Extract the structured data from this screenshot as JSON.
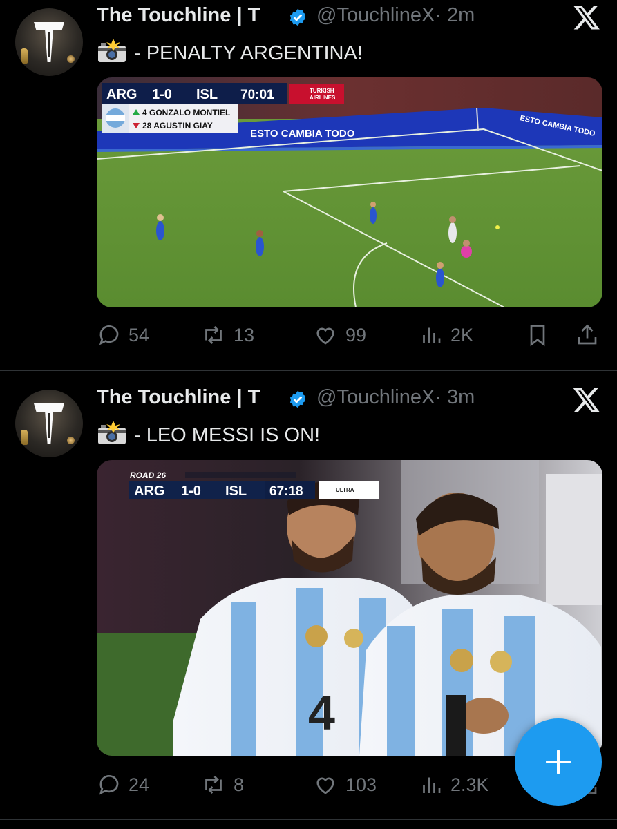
{
  "tweets": [
    {
      "author_name": "The Touchline | T",
      "handle": "@TouchlineX",
      "time": "· 2m",
      "text": "- PENALTY ARGENTINA!",
      "media": {
        "home": "ARG",
        "score": "1-0",
        "away": "ISL",
        "clock": "70:01",
        "sponsor_line1": "TURKISH",
        "sponsor_line2": "AIRLINES",
        "sub_in": "4 GONZALO MONTIEL",
        "sub_out": "28 AGUSTIN GIAY",
        "board_text": "ESTO CAMBIA TODO",
        "board_text_right": "ESTO CAMBIA TODO"
      },
      "counts": {
        "replies": "54",
        "reposts": "13",
        "likes": "99",
        "views": "2K"
      }
    },
    {
      "author_name": "The Touchline | T",
      "handle": "@TouchlineX",
      "time": "· 3m",
      "text": "- LEO MESSI IS ON!",
      "media": {
        "banner": "ROAD 26",
        "home": "ARG",
        "score": "1-0",
        "away": "ISL",
        "clock": "67:18",
        "sponsor": "ULTRA",
        "shirt_number": "4"
      },
      "counts": {
        "replies": "24",
        "reposts": "8",
        "likes": "103",
        "views": "2.3K"
      }
    }
  ],
  "icons": [
    "camera-flash-icon",
    "verified-badge-icon",
    "x-logo-icon",
    "reply-icon",
    "repost-icon",
    "like-icon",
    "views-icon",
    "bookmark-icon",
    "share-icon",
    "compose-plus-icon"
  ],
  "colors": {
    "background": "#000000",
    "accent": "#1d9bf0",
    "muted": "#71767b",
    "text": "#e7e9ea"
  }
}
